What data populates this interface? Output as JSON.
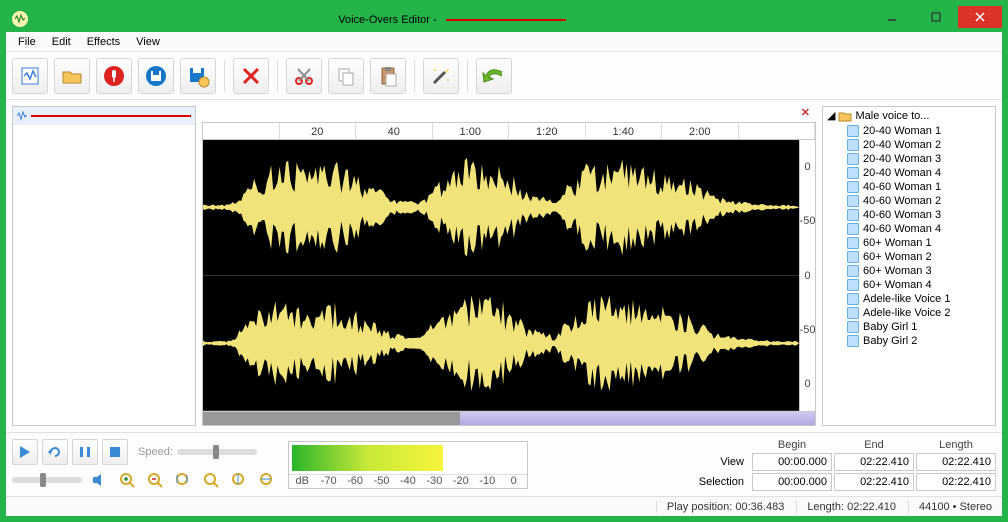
{
  "title_app": "Voice-Overs Editor - ",
  "menus": [
    "File",
    "Edit",
    "Effects",
    "View"
  ],
  "ruler_ticks": [
    "",
    "20",
    "40",
    "1:00",
    "1:20",
    "1:40",
    "2:00",
    ""
  ],
  "amp_labels": [
    "0",
    "-50",
    "0",
    "-50",
    "0"
  ],
  "tree_root": "Male voice to...",
  "tree_items": [
    "20-40 Woman 1",
    "20-40 Woman 2",
    "20-40 Woman 3",
    "20-40 Woman 4",
    "40-60 Woman 1",
    "40-60 Woman 2",
    "40-60 Woman 3",
    "40-60 Woman 4",
    "60+ Woman 1",
    "60+ Woman 2",
    "60+ Woman 3",
    "60+ Woman 4",
    "Adele-like Voice 1",
    "Adele-like Voice 2",
    "Baby Girl 1",
    "Baby Girl 2"
  ],
  "speed_label": "Speed:",
  "db_label": "dB",
  "meter_ticks": [
    "-70",
    "-60",
    "-50",
    "-40",
    "-30",
    "-20",
    "-10",
    "0"
  ],
  "grid": {
    "headers": [
      "Begin",
      "End",
      "Length"
    ],
    "rows": [
      {
        "label": "View",
        "begin": "00:00.000",
        "end": "02:22.410",
        "len": "02:22.410"
      },
      {
        "label": "Selection",
        "begin": "00:00.000",
        "end": "02:22.410",
        "len": "02:22.410"
      }
    ]
  },
  "status": {
    "playpos_label": "Play position:",
    "playpos": "00:36.483",
    "length_label": "Length:",
    "length": "02:22.410",
    "rate": "44100",
    "channels": "Stereo"
  }
}
